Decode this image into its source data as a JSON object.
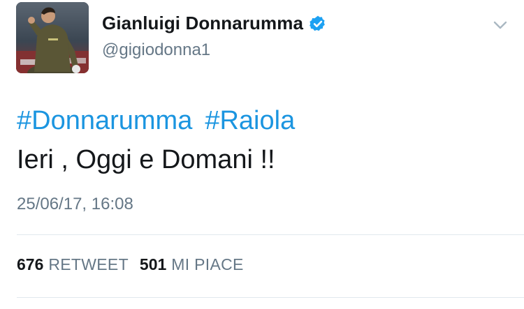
{
  "tweet": {
    "author": {
      "display_name": "Gianluigi Donnarumma",
      "handle": "@gigiodonna1",
      "verified": true,
      "avatar_icon": "player-photo-avatar"
    },
    "hashtags": [
      "#Donnarumma",
      "#Raiola"
    ],
    "text": "Ieri , Oggi e Domani !!",
    "timestamp": "25/06/17, 16:08",
    "stats": {
      "retweets_count": "676",
      "retweets_label": "RETWEET",
      "likes_count": "501",
      "likes_label": "MI PIACE"
    }
  },
  "icons": {
    "verified": "verified-badge-icon",
    "menu": "chevron-down-icon"
  },
  "colors": {
    "link": "#1b95e0",
    "verified": "#1da1f2",
    "secondary_text": "#657786",
    "primary_text": "#14171a",
    "divider": "#e1e8ed"
  }
}
